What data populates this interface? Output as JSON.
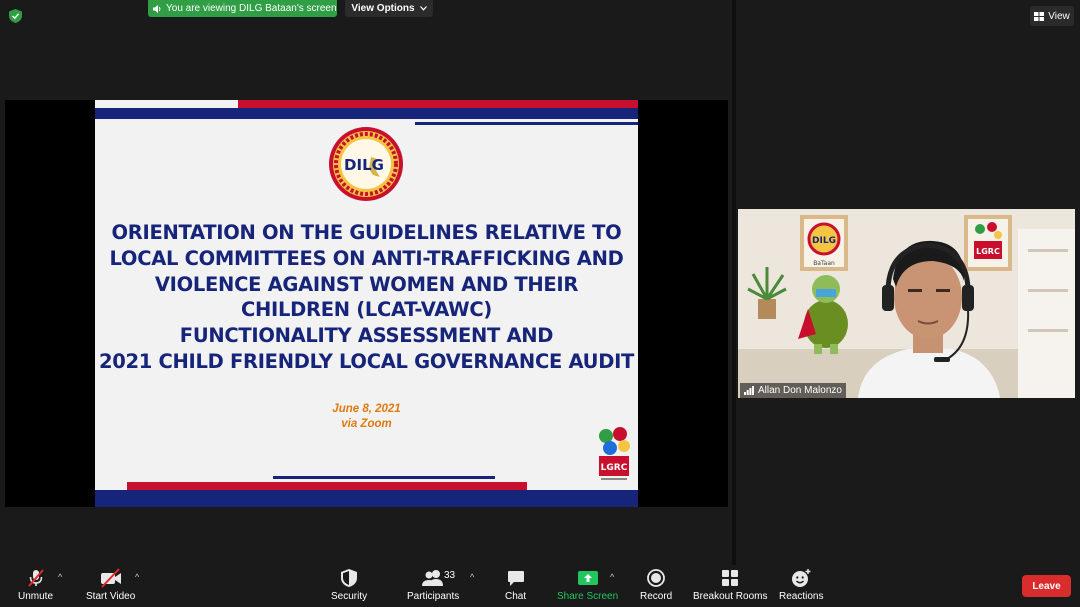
{
  "banner": {
    "viewing_text": "You are viewing DILG Bataan's screen",
    "view_options": "View Options"
  },
  "top_right": {
    "view_label": "View"
  },
  "slide": {
    "logo_text": "DILG",
    "title_lines": [
      "ORIENTATION ON THE GUIDELINES RELATIVE TO",
      "LOCAL COMMITTEES ON ANTI-TRAFFICKING AND",
      "VIOLENCE AGAINST WOMEN AND THEIR",
      "CHILDREN (LCAT-VAWC)",
      "FUNCTIONALITY ASSESSMENT AND",
      "2021 CHILD FRIENDLY LOCAL GOVERNANCE AUDIT"
    ],
    "date": "June 8, 2021",
    "via": "via Zoom",
    "lgrc_logo_text": "LGRC"
  },
  "participant": {
    "name": "Allan Don Malonzo",
    "bg_logo_text": "DILG",
    "bg_logo_sub": "BaTaan",
    "bg_logo2_text": "LGRC"
  },
  "toolbar": {
    "unmute": "Unmute",
    "start_video": "Start Video",
    "security": "Security",
    "participants": "Participants",
    "participant_count": "33",
    "chat": "Chat",
    "share_screen": "Share Screen",
    "record": "Record",
    "breakout_rooms": "Breakout Rooms",
    "reactions": "Reactions",
    "leave": "Leave"
  },
  "colors": {
    "share_green": "#2f9e44",
    "slide_navy": "#16247a",
    "slide_red": "#c8102e",
    "date_orange": "#e07a10",
    "leave_red": "#d92d2d"
  }
}
